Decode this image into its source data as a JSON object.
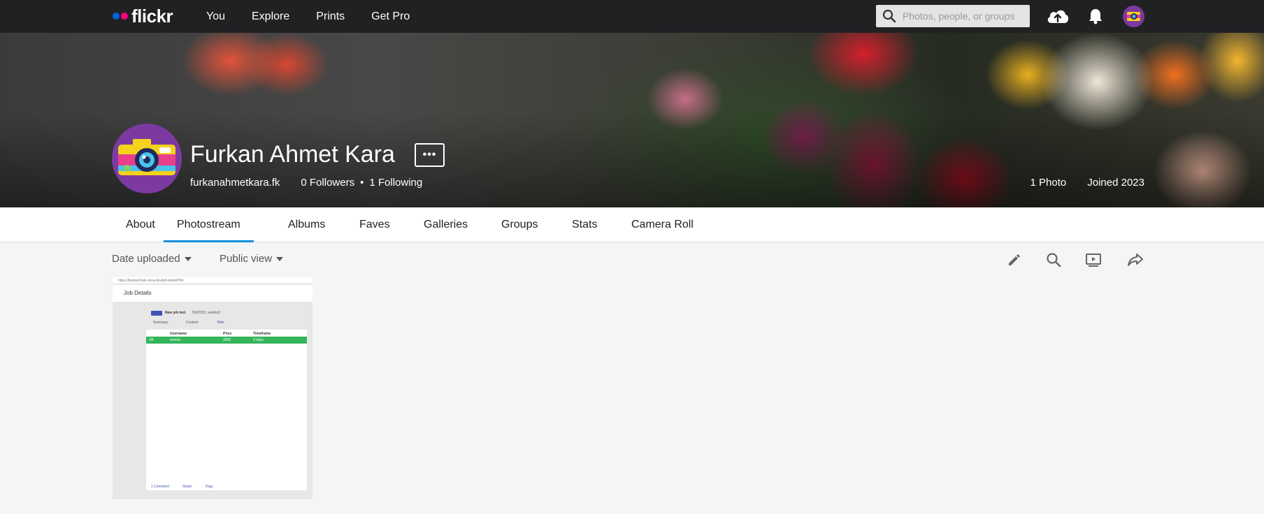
{
  "topbar": {
    "logo": "flickr",
    "nav": [
      "You",
      "Explore",
      "Prints",
      "Get Pro"
    ],
    "search_placeholder": "Photos, people, or groups",
    "icons": [
      "search-icon",
      "upload-cloud-icon",
      "notifications-bell-icon",
      "user-avatar"
    ]
  },
  "profile": {
    "name": "Furkan Ahmet Kara",
    "more_label": "•••",
    "username": "furkanahmetkara.fk",
    "followers": "0 Followers",
    "bullet": "•",
    "following": "1 Following",
    "photo_count": "1 Photo",
    "joined": "Joined 2023"
  },
  "tabs": [
    "About",
    "Photostream",
    "Albums",
    "Faves",
    "Galleries",
    "Groups",
    "Stats",
    "Camera Roll"
  ],
  "active_tab": "Photostream",
  "toolbar": {
    "sort_label": "Date uploaded",
    "view_label": "Public view",
    "icons": [
      "edit-pencil-icon",
      "search-icon",
      "slideshow-icon",
      "share-icon"
    ]
  },
  "photo": {
    "url": "https://testanchain.ossa.dev/job-detail/254",
    "header": "Job Details",
    "job_title": "New job test",
    "job_meta": "5/6/2023, vendor2",
    "tabs": [
      "Summary",
      "Content",
      "Bids"
    ],
    "columns": [
      "Username",
      "Price",
      "Timeframe"
    ],
    "row": [
      "VA",
      "vendor",
      "300€",
      "3 days"
    ],
    "footer": [
      "1 Comment",
      "Share",
      "Flag"
    ]
  },
  "colors": {
    "topbar_bg": "#212124",
    "active_tab_underline": "#128fdc",
    "logo_blue": "#0063dc",
    "logo_pink": "#ff0084",
    "page_bg": "#f3f5f6",
    "bid_row": "#34b55a"
  }
}
